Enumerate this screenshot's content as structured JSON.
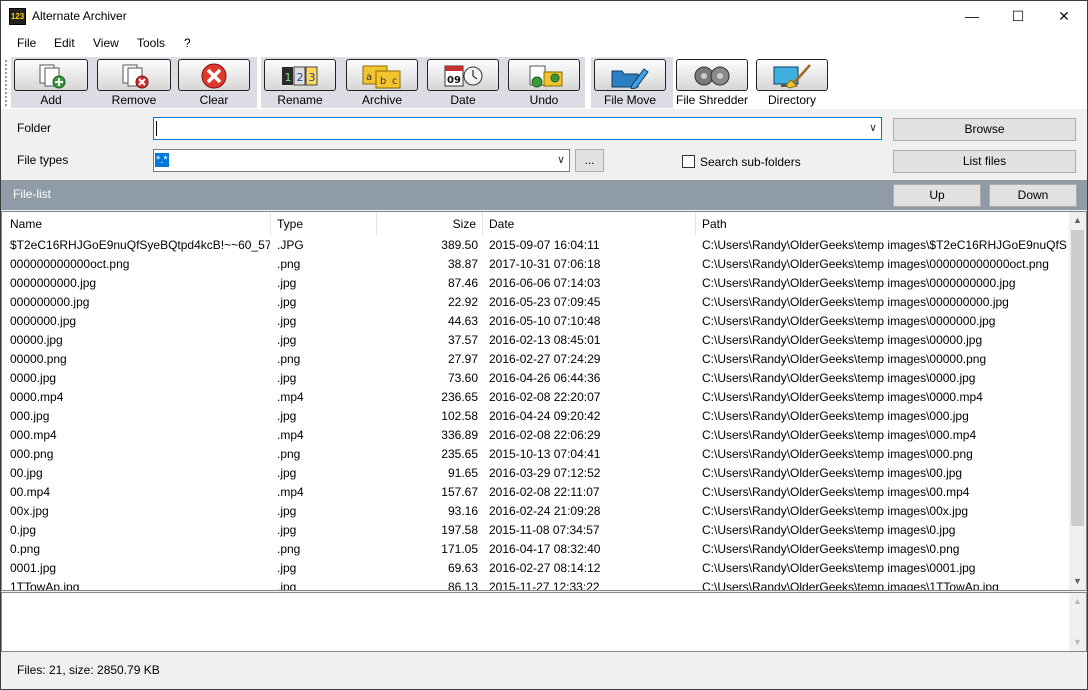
{
  "window": {
    "title": "Alternate Archiver",
    "icon_text": "123"
  },
  "window_controls": {
    "minimize": "—",
    "maximize": "☐",
    "close": "✕"
  },
  "menu": [
    "File",
    "Edit",
    "View",
    "Tools",
    "?"
  ],
  "toolbar": {
    "add": "Add",
    "remove": "Remove",
    "clear": "Clear",
    "rename": "Rename",
    "archive": "Archive",
    "date": "Date",
    "undo": "Undo",
    "file_move": "File Move",
    "file_shredder": "File Shredder",
    "directory": "Directory",
    "date_icon_text": "09"
  },
  "filters": {
    "folder_label": "Folder",
    "folder_value": "",
    "file_types_label": "File types",
    "file_types_value": "*.*",
    "ellipsis": "...",
    "search_sub": "Search sub-folders",
    "browse": "Browse",
    "list_files": "List files"
  },
  "filelist": {
    "title": "File-list",
    "up": "Up",
    "down": "Down"
  },
  "columns": {
    "name": "Name",
    "type": "Type",
    "size": "Size",
    "date": "Date",
    "path": "Path"
  },
  "rows": [
    {
      "name": "$T2eC16RHJGoE9nuQfSyeBQtpd4kcB!~~60_57....",
      "type": ".JPG",
      "size": "389.50",
      "date": "2015-09-07 16:04:11",
      "path": "C:\\Users\\Randy\\OlderGeeks\\temp images\\$T2eC16RHJGoE9nuQfS..."
    },
    {
      "name": "000000000000oct.png",
      "type": ".png",
      "size": "38.87",
      "date": "2017-10-31 07:06:18",
      "path": "C:\\Users\\Randy\\OlderGeeks\\temp images\\000000000000oct.png"
    },
    {
      "name": "0000000000.jpg",
      "type": ".jpg",
      "size": "87.46",
      "date": "2016-06-06 07:14:03",
      "path": "C:\\Users\\Randy\\OlderGeeks\\temp images\\0000000000.jpg"
    },
    {
      "name": "000000000.jpg",
      "type": ".jpg",
      "size": "22.92",
      "date": "2016-05-23 07:09:45",
      "path": "C:\\Users\\Randy\\OlderGeeks\\temp images\\000000000.jpg"
    },
    {
      "name": "0000000.jpg",
      "type": ".jpg",
      "size": "44.63",
      "date": "2016-05-10 07:10:48",
      "path": "C:\\Users\\Randy\\OlderGeeks\\temp images\\0000000.jpg"
    },
    {
      "name": "00000.jpg",
      "type": ".jpg",
      "size": "37.57",
      "date": "2016-02-13 08:45:01",
      "path": "C:\\Users\\Randy\\OlderGeeks\\temp images\\00000.jpg"
    },
    {
      "name": "00000.png",
      "type": ".png",
      "size": "27.97",
      "date": "2016-02-27 07:24:29",
      "path": "C:\\Users\\Randy\\OlderGeeks\\temp images\\00000.png"
    },
    {
      "name": "0000.jpg",
      "type": ".jpg",
      "size": "73.60",
      "date": "2016-04-26 06:44:36",
      "path": "C:\\Users\\Randy\\OlderGeeks\\temp images\\0000.jpg"
    },
    {
      "name": "0000.mp4",
      "type": ".mp4",
      "size": "236.65",
      "date": "2016-02-08 22:20:07",
      "path": "C:\\Users\\Randy\\OlderGeeks\\temp images\\0000.mp4"
    },
    {
      "name": "000.jpg",
      "type": ".jpg",
      "size": "102.58",
      "date": "2016-04-24 09:20:42",
      "path": "C:\\Users\\Randy\\OlderGeeks\\temp images\\000.jpg"
    },
    {
      "name": "000.mp4",
      "type": ".mp4",
      "size": "336.89",
      "date": "2016-02-08 22:06:29",
      "path": "C:\\Users\\Randy\\OlderGeeks\\temp images\\000.mp4"
    },
    {
      "name": "000.png",
      "type": ".png",
      "size": "235.65",
      "date": "2015-10-13 07:04:41",
      "path": "C:\\Users\\Randy\\OlderGeeks\\temp images\\000.png"
    },
    {
      "name": "00.jpg",
      "type": ".jpg",
      "size": "91.65",
      "date": "2016-03-29 07:12:52",
      "path": "C:\\Users\\Randy\\OlderGeeks\\temp images\\00.jpg"
    },
    {
      "name": "00.mp4",
      "type": ".mp4",
      "size": "157.67",
      "date": "2016-02-08 22:11:07",
      "path": "C:\\Users\\Randy\\OlderGeeks\\temp images\\00.mp4"
    },
    {
      "name": "00x.jpg",
      "type": ".jpg",
      "size": "93.16",
      "date": "2016-02-24 21:09:28",
      "path": "C:\\Users\\Randy\\OlderGeeks\\temp images\\00x.jpg"
    },
    {
      "name": "0.jpg",
      "type": ".jpg",
      "size": "197.58",
      "date": "2015-11-08 07:34:57",
      "path": "C:\\Users\\Randy\\OlderGeeks\\temp images\\0.jpg"
    },
    {
      "name": "0.png",
      "type": ".png",
      "size": "171.05",
      "date": "2016-04-17 08:32:40",
      "path": "C:\\Users\\Randy\\OlderGeeks\\temp images\\0.png"
    },
    {
      "name": "0001.jpg",
      "type": ".jpg",
      "size": "69.63",
      "date": "2016-02-27 08:14:12",
      "path": "C:\\Users\\Randy\\OlderGeeks\\temp images\\0001.jpg"
    },
    {
      "name": "1TTowAp.jpg",
      "type": ".jpg",
      "size": "86.13",
      "date": "2015-11-27 12:33:22",
      "path": "C:\\Users\\Randy\\OlderGeeks\\temp images\\1TTowAp.jpg"
    }
  ],
  "status": "Files: 21, size: 2850.79 KB"
}
